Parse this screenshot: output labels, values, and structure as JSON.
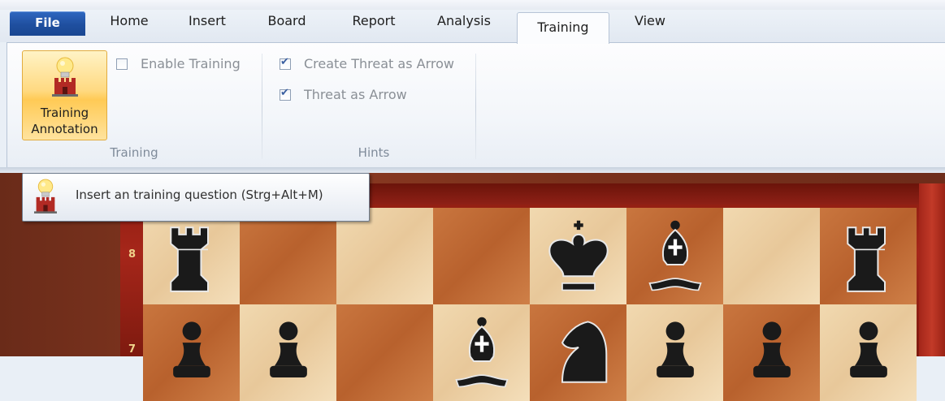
{
  "tabs": {
    "file": "File",
    "home": "Home",
    "insert": "Insert",
    "board": "Board",
    "report": "Report",
    "analysis": "Analysis",
    "training": "Training",
    "view": "View",
    "active": "Training"
  },
  "ribbon": {
    "training_group": {
      "big_button_line1": "Training",
      "big_button_line2": "Annotation",
      "big_button_icon": "lightbulb-castle-icon",
      "enable_training_label": "Enable Training",
      "enable_training_checked": false,
      "group_label": "Training"
    },
    "hints_group": {
      "create_threat_label": "Create Threat as Arrow",
      "create_threat_checked": true,
      "threat_arrow_label": "Threat as Arrow",
      "threat_arrow_checked": true,
      "group_label": "Hints"
    }
  },
  "tooltip": {
    "text": "Insert an training question (Strg+Alt+M)",
    "icon": "lightbulb-castle-icon"
  },
  "board": {
    "rank_labels": [
      "8",
      "7"
    ],
    "rank8": [
      "R",
      "",
      "",
      "",
      "K",
      "B",
      "",
      "R"
    ],
    "rank7": [
      "P",
      "P",
      "",
      "B",
      "N",
      "P",
      "P",
      "P"
    ],
    "piece_color": "black",
    "colors": {
      "light": "#f1d9b0",
      "dark": "#c36a35",
      "frame": "#9b2318"
    }
  }
}
